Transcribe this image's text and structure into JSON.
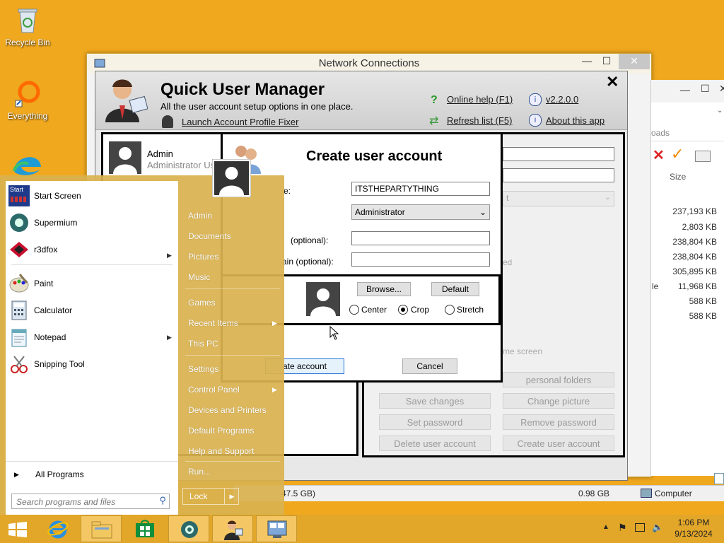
{
  "desktop": {
    "icons": [
      {
        "label": "Recycle Bin"
      },
      {
        "label": "Everything"
      }
    ]
  },
  "network_window": {
    "title": "Network Connections",
    "search_hint": "oads",
    "column_size": "Size",
    "sizes": [
      "237,193 KB",
      "2,803 KB",
      "238,804 KB",
      "238,804 KB",
      "305,895 KB",
      "11,968 KB",
      "588 KB",
      "588 KB"
    ],
    "left_label": "le",
    "status_size": "0.98 GB",
    "status_disk": "47.5 GB)",
    "status_computer": "Computer",
    "nav_computer": "Computer"
  },
  "qum": {
    "app_title": "Quick User Manager",
    "subtitle": "All the user account setup options in one place.",
    "launch_fixer": "Launch Account Profile Fixer",
    "online_help": "Online help (F1)",
    "refresh_list": "Refresh list (F5)",
    "version": "v2.2.0.0",
    "about": "About this app",
    "user_name": "Admin",
    "user_role": "Administrator Us",
    "right_partial_1": "t",
    "right_partial_2": "ed",
    "right_partial_3": "me screen",
    "buttons": {
      "personal_folders": "personal folders",
      "save_changes": "Save changes",
      "change_picture": "Change picture",
      "set_password": "Set password",
      "remove_password": "Remove password",
      "delete_account": "Delete user account",
      "create_account": "Create user account"
    }
  },
  "dialog": {
    "title": "Create user account",
    "name_label": "e:",
    "name_value": "ITSTHEPARTYTHING",
    "type_value": "Administrator",
    "password_label": "(optional):",
    "domain_label": "ain (optional):",
    "browse": "Browse...",
    "default": "Default",
    "center": "Center",
    "crop": "Crop",
    "stretch": "Stretch",
    "create": "ate account",
    "cancel": "Cancel"
  },
  "start_menu": {
    "left_items": [
      {
        "label": "Start Screen"
      },
      {
        "label": "Supermium"
      },
      {
        "label": "r3dfox"
      },
      {
        "label": "Paint"
      },
      {
        "label": "Calculator"
      },
      {
        "label": "Notepad"
      },
      {
        "label": "Snipping Tool"
      }
    ],
    "start_badge": "Start",
    "all_programs": "All Programs",
    "search_placeholder": "Search programs and files",
    "right_items": [
      {
        "label": "Admin"
      },
      {
        "label": "Documents"
      },
      {
        "label": "Pictures"
      },
      {
        "label": "Music"
      },
      {
        "label": "Games"
      },
      {
        "label": "Recent Items"
      },
      {
        "label": "This PC"
      },
      {
        "label": "Settings"
      },
      {
        "label": "Control Panel"
      },
      {
        "label": "Devices and Printers"
      },
      {
        "label": "Default Programs"
      },
      {
        "label": "Help and Support"
      },
      {
        "label": "Run..."
      }
    ],
    "lock": "Lock"
  },
  "taskbar": {
    "time": "1:06 PM",
    "date": "9/13/2024"
  },
  "colors": {
    "desktop": "#f0a81e",
    "start_panel": "#d9b14f",
    "taskbar": "#e2a629"
  }
}
